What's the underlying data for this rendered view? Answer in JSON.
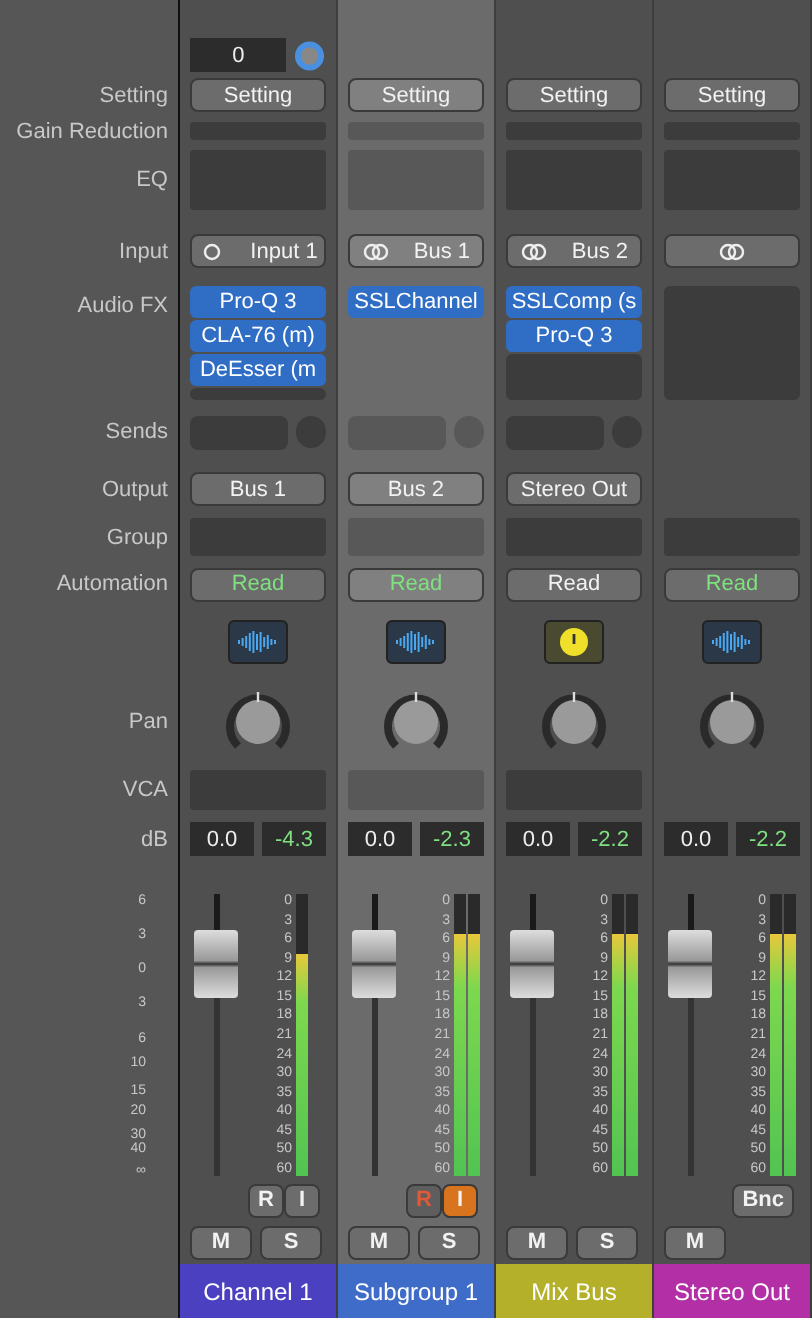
{
  "row_labels": {
    "setting": "Setting",
    "gain": "Gain Reduction",
    "eq": "EQ",
    "input": "Input",
    "fx": "Audio FX",
    "sends": "Sends",
    "output": "Output",
    "group": "Group",
    "automation": "Automation",
    "pan": "Pan",
    "vca": "VCA",
    "db": "dB"
  },
  "fader_scale": [
    "6",
    "3",
    "0",
    "3",
    "6",
    "10",
    "15",
    "20",
    "30",
    "40",
    "∞"
  ],
  "strips": [
    {
      "selected": false,
      "gain_field": "0",
      "setting": "Setting",
      "input": {
        "kind": "mono",
        "label": "Input 1"
      },
      "audio_fx": [
        "Pro-Q 3",
        "CLA-76 (m)",
        "DeEsser (m"
      ],
      "send": true,
      "output": "Bus 1",
      "automation": {
        "label": "Read",
        "highlighted": true
      },
      "icon": {
        "kind": "waveform"
      },
      "vca": true,
      "volume": "0.0",
      "peak": "-4.3",
      "fader": {
        "level": 0.75
      },
      "meter_scale": [
        "0",
        "3",
        "6",
        "9",
        "12",
        "15",
        "18",
        "21",
        "24",
        "30",
        "35",
        "40",
        "45",
        "50",
        "60"
      ],
      "meters": [
        {
          "level": 0.79
        }
      ],
      "buttons": [
        {
          "kind": "record",
          "label": "R",
          "on": false
        },
        {
          "kind": "monitor",
          "label": "I",
          "on": false
        }
      ],
      "mute": "M",
      "solo": "S",
      "name": "Channel 1",
      "color": "#4a40c0"
    },
    {
      "selected": true,
      "setting": "Setting",
      "input": {
        "kind": "stereo",
        "label": "Bus 1"
      },
      "audio_fx": [
        "SSLChannel"
      ],
      "send": true,
      "output": "Bus 2",
      "automation": {
        "label": "Read",
        "highlighted": true
      },
      "icon": {
        "kind": "waveform"
      },
      "vca": true,
      "volume": "0.0",
      "peak": "-2.3",
      "fader": {
        "level": 0.75
      },
      "meter_scale": [
        "0",
        "3",
        "6",
        "9",
        "12",
        "15",
        "18",
        "21",
        "24",
        "30",
        "35",
        "40",
        "45",
        "50",
        "60"
      ],
      "meters": [
        {
          "level": 0.86
        },
        {
          "level": 0.86
        }
      ],
      "buttons": [
        {
          "kind": "record",
          "label": "R",
          "on": true
        },
        {
          "kind": "monitor",
          "label": "I",
          "on": true
        }
      ],
      "mute": "M",
      "solo": "S",
      "name": "Subgroup 1",
      "color": "#3f6cc8"
    },
    {
      "selected": false,
      "setting": "Setting",
      "input": {
        "kind": "stereo",
        "label": "Bus 2"
      },
      "audio_fx": [
        "SSLComp (s",
        "Pro-Q 3"
      ],
      "send": true,
      "output": "Stereo Out",
      "automation": {
        "label": "Read",
        "highlighted": false
      },
      "icon": {
        "kind": "dial"
      },
      "vca": true,
      "volume": "0.0",
      "peak": "-2.2",
      "fader": {
        "level": 0.75
      },
      "meter_scale": [
        "0",
        "3",
        "6",
        "9",
        "12",
        "15",
        "18",
        "21",
        "24",
        "30",
        "35",
        "40",
        "45",
        "50",
        "60"
      ],
      "meters": [
        {
          "level": 0.86
        },
        {
          "level": 0.86
        }
      ],
      "mute": "M",
      "solo": "S",
      "name": "Mix Bus",
      "color": "#b4b02a"
    },
    {
      "selected": false,
      "setting": "Setting",
      "input": {
        "kind": "stereo"
      },
      "send": false,
      "automation": {
        "label": "Read",
        "highlighted": true
      },
      "icon": {
        "kind": "waveform"
      },
      "vca": false,
      "volume": "0.0",
      "peak": "-2.2",
      "fader": {
        "level": 0.75
      },
      "meter_scale": [
        "0",
        "3",
        "6",
        "9",
        "12",
        "15",
        "18",
        "21",
        "24",
        "30",
        "35",
        "40",
        "45",
        "50",
        "60"
      ],
      "meters": [
        {
          "level": 0.86
        },
        {
          "level": 0.86
        }
      ],
      "buttons": [
        {
          "kind": "bounce",
          "label": "Bnc",
          "on": false
        }
      ],
      "mute": "M",
      "name": "Stereo Out",
      "color": "#b22fa6"
    }
  ]
}
